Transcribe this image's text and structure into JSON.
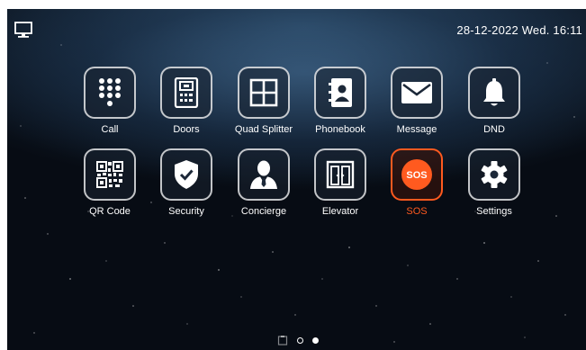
{
  "status_bar": {
    "datetime": "28-12-2022 Wed. 16:11",
    "left_icon": "monitor-icon"
  },
  "tiles": [
    {
      "label": "Call",
      "icon": "keypad-icon"
    },
    {
      "label": "Doors",
      "icon": "door-station-icon"
    },
    {
      "label": "Quad Splitter",
      "icon": "quad-grid-icon"
    },
    {
      "label": "Phonebook",
      "icon": "phonebook-icon"
    },
    {
      "label": "Message",
      "icon": "envelope-icon"
    },
    {
      "label": "DND",
      "icon": "bell-icon"
    },
    {
      "label": "QR Code",
      "icon": "qr-code-icon"
    },
    {
      "label": "Security",
      "icon": "shield-check-icon"
    },
    {
      "label": "Concierge",
      "icon": "concierge-person-icon"
    },
    {
      "label": "Elevator",
      "icon": "elevator-icon"
    },
    {
      "label": "SOS",
      "icon": "sos-icon",
      "sos_text": "SOS"
    },
    {
      "label": "Settings",
      "icon": "gear-icon"
    }
  ],
  "pager": {
    "page_count": 2,
    "current_page": 2,
    "icon": "home-page-icon"
  },
  "colors": {
    "accent_sos": "#ff5a1f",
    "text": "#ffffff",
    "tile_border": "#ffffff"
  }
}
